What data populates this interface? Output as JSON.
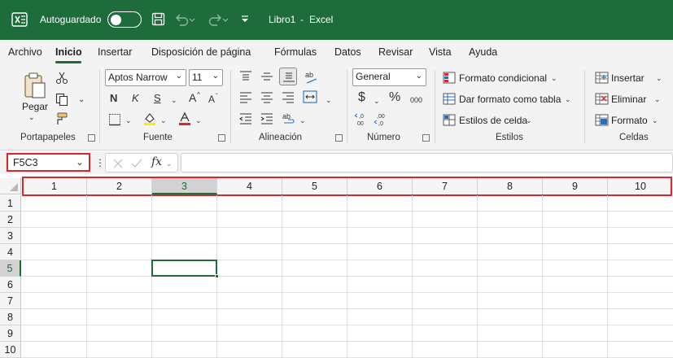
{
  "titlebar": {
    "autosave_label": "Autoguardado",
    "file_title": "Libro1",
    "title_sep": "-",
    "app_name": "Excel"
  },
  "tabs": [
    "Archivo",
    "Inicio",
    "Insertar",
    "Disposición de página",
    "Fórmulas",
    "Datos",
    "Revisar",
    "Vista",
    "Ayuda"
  ],
  "active_tab": "Inicio",
  "ribbon": {
    "clipboard": {
      "paste_label": "Pegar",
      "group_label": "Portapapeles"
    },
    "font": {
      "name": "Aptos Narrow",
      "size": "11",
      "bold": "N",
      "italic": "K",
      "underline": "S",
      "grow": "A",
      "shrink": "A",
      "group_label": "Fuente"
    },
    "alignment": {
      "group_label": "Alineación"
    },
    "number": {
      "format": "General",
      "currency": "$",
      "percent": "%",
      "thousands": "000",
      "group_label": "Número"
    },
    "styles": {
      "conditional": "Formato condicional",
      "as_table": "Dar formato como tabla",
      "cell_styles": "Estilos de celda",
      "group_label": "Estilos"
    },
    "cells": {
      "insert": "Insertar",
      "delete": "Eliminar",
      "format": "Formato",
      "group_label": "Celdas"
    }
  },
  "formula_bar": {
    "name_box": "F5C3",
    "fx": "fx",
    "value": ""
  },
  "grid": {
    "columns": [
      "1",
      "2",
      "3",
      "4",
      "5",
      "6",
      "7",
      "8",
      "9",
      "10"
    ],
    "rows": [
      "1",
      "2",
      "3",
      "4",
      "5",
      "6",
      "7",
      "8",
      "9",
      "10"
    ],
    "active_row": "5",
    "active_col": "3"
  },
  "colors": {
    "accent": "#1e6c3c",
    "highlight": "#d9252b"
  }
}
